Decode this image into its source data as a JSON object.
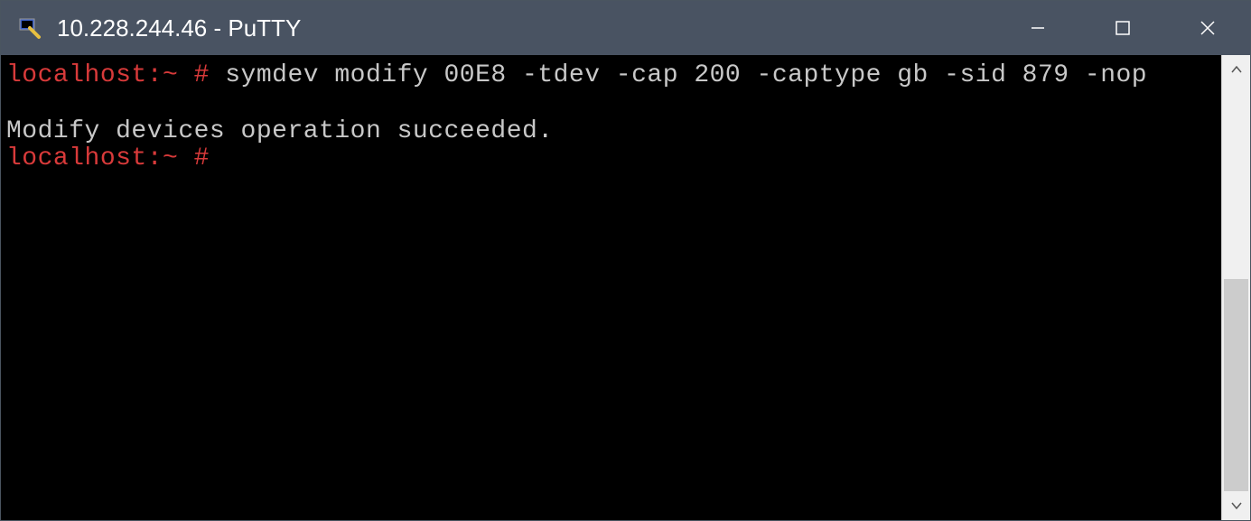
{
  "window": {
    "title": "10.228.244.46 - PuTTY"
  },
  "terminal": {
    "lines": [
      {
        "prompt": "localhost:~ #",
        "command": " symdev modify 00E8 -tdev -cap 200 -captype gb -sid 879 -nop"
      },
      {
        "blank": true
      },
      {
        "output": "Modify devices operation succeeded."
      },
      {
        "prompt": "localhost:~ #",
        "command": ""
      }
    ]
  }
}
